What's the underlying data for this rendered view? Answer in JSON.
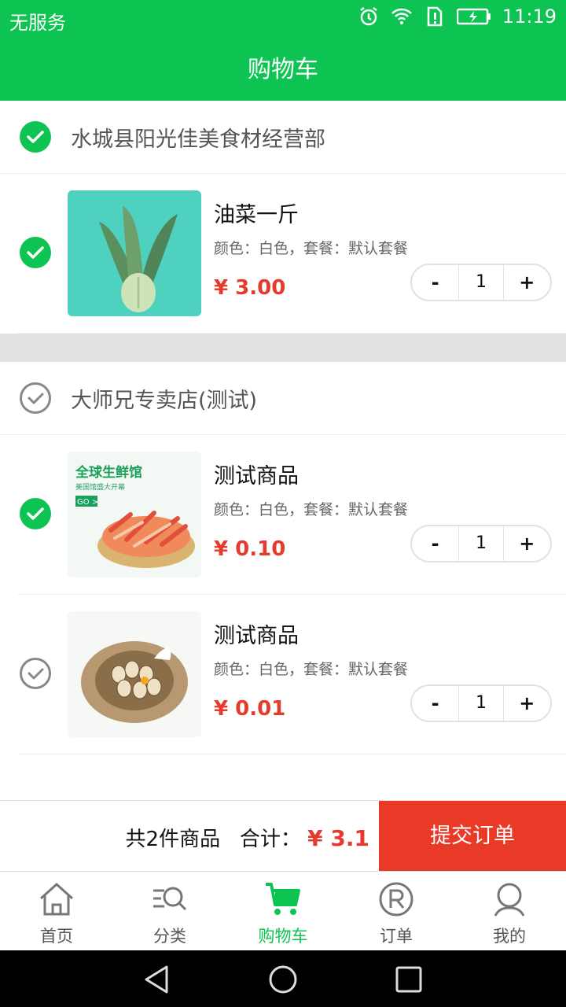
{
  "status_bar": {
    "carrier": "无服务",
    "time": "11:19"
  },
  "header": {
    "title": "购物车"
  },
  "shops": [
    {
      "name": "水城县阳光佳美食材经营部",
      "checked": true,
      "items": [
        {
          "title": "油菜一斤",
          "spec": "颜色：白色，套餐：默认套餐",
          "price": "¥ 3.00",
          "qty": "1",
          "checked": true,
          "image": "bok-choy"
        }
      ]
    },
    {
      "name": "大师兄专卖店(测试)",
      "checked": false,
      "items": [
        {
          "title": "测试商品",
          "spec": "颜色：白色，套餐：默认套餐",
          "price": "¥ 0.10",
          "qty": "1",
          "checked": true,
          "image": "seafood-banner",
          "image_text": [
            "全球生鲜馆",
            "美国馆盛大开幕",
            "GO >"
          ]
        },
        {
          "title": "测试商品",
          "spec": "颜色：白色，套餐：默认套餐",
          "price": "¥ 0.01",
          "qty": "1",
          "checked": false,
          "image": "quail-eggs-nest"
        }
      ]
    }
  ],
  "stepper": {
    "minus": "-",
    "plus": "+"
  },
  "summary": {
    "count_label": "共2件商品",
    "total_label": "合计：",
    "total_value": "¥ 3.1",
    "submit_label": "提交订单"
  },
  "tabs": [
    {
      "label": "首页",
      "icon": "home-icon",
      "active": false
    },
    {
      "label": "分类",
      "icon": "category-search-icon",
      "active": false
    },
    {
      "label": "购物车",
      "icon": "cart-icon",
      "active": true
    },
    {
      "label": "订单",
      "icon": "registered-icon",
      "active": false
    },
    {
      "label": "我的",
      "icon": "profile-icon",
      "active": false
    }
  ],
  "colors": {
    "brand_green": "#0dc452",
    "price_red": "#e53b2c",
    "submit_red": "#e83a27"
  }
}
